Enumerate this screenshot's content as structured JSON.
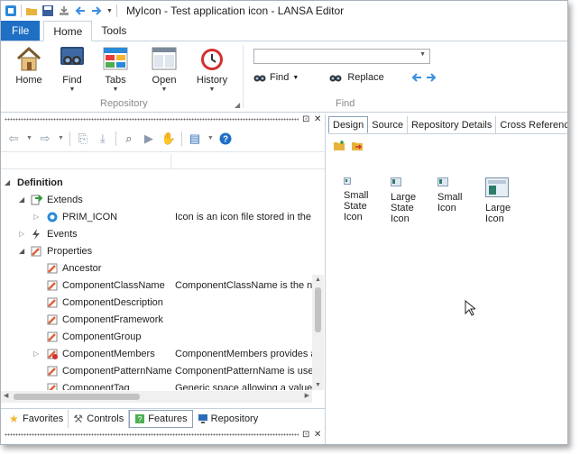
{
  "window": {
    "title": "MyIcon - Test application icon - LANSA Editor"
  },
  "ribbon": {
    "tabs": [
      {
        "label": "File"
      },
      {
        "label": "Home"
      },
      {
        "label": "Tools"
      }
    ],
    "buttons": {
      "home": "Home",
      "find": "Find",
      "tabs": "Tabs",
      "open": "Open",
      "history": "History"
    },
    "groups": {
      "repository": "Repository",
      "find": "Find"
    },
    "find_input_value": "",
    "find_button": "Find",
    "replace_button": "Replace"
  },
  "tree": {
    "rows": [
      {
        "name": "Definition",
        "desc": ""
      },
      {
        "name": "Extends",
        "desc": ""
      },
      {
        "name": "PRIM_ICON",
        "desc": "Icon is an icon file stored in the r"
      },
      {
        "name": "Events",
        "desc": ""
      },
      {
        "name": "Properties",
        "desc": ""
      },
      {
        "name": "Ancestor",
        "desc": ""
      },
      {
        "name": "ComponentClassName",
        "desc": "ComponentClassName is the na"
      },
      {
        "name": "ComponentDescription",
        "desc": ""
      },
      {
        "name": "ComponentFramework",
        "desc": ""
      },
      {
        "name": "ComponentGroup",
        "desc": ""
      },
      {
        "name": "ComponentMembers",
        "desc": "ComponentMembers provides a"
      },
      {
        "name": "ComponentPatternName",
        "desc": "ComponentPatternName is used"
      },
      {
        "name": "ComponentTag",
        "desc": "Generic space allowing a value t"
      }
    ]
  },
  "bottom_tabs": [
    {
      "label": "Favorites"
    },
    {
      "label": "Controls"
    },
    {
      "label": "Features"
    },
    {
      "label": "Repository"
    }
  ],
  "right_tabs": [
    {
      "label": "Design"
    },
    {
      "label": "Source"
    },
    {
      "label": "Repository Details"
    },
    {
      "label": "Cross References"
    }
  ],
  "design_controls": [
    {
      "label": "Small\nState\nIcon"
    },
    {
      "label": "Large\nState\nIcon"
    },
    {
      "label": "Small\nIcon"
    },
    {
      "label": "Large\nIcon"
    }
  ],
  "colors": {
    "file_tab": "#1f6fc5",
    "accent_blue": "#2b8ad8",
    "history_red": "#d32f2f"
  }
}
